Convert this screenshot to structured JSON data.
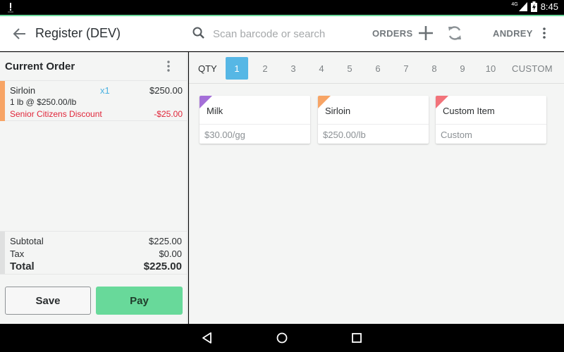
{
  "status_bar": {
    "network": "4G",
    "time": "8:45"
  },
  "app_bar": {
    "title": "Register (DEV)",
    "search_placeholder": "Scan barcode or search",
    "orders_label": "ORDERS",
    "user_label": "ANDREY"
  },
  "current_order": {
    "title": "Current Order",
    "items": [
      {
        "name": "Sirloin",
        "qty": "x1",
        "price": "$250.00",
        "detail": "1 lb @ $250.00/lb",
        "discount_name": "Senior Citizens Discount",
        "discount_value": "-$25.00",
        "color": "#f7a465"
      }
    ],
    "totals": {
      "subtotal_label": "Subtotal",
      "subtotal": "$225.00",
      "tax_label": "Tax",
      "tax": "$0.00",
      "total_label": "Total",
      "total": "$225.00"
    },
    "save_label": "Save",
    "pay_label": "Pay"
  },
  "qty_bar": {
    "label": "QTY",
    "options": [
      "1",
      "2",
      "3",
      "4",
      "5",
      "6",
      "7",
      "8",
      "9",
      "10"
    ],
    "selected": "1",
    "custom_label": "CUSTOM"
  },
  "products": [
    {
      "name": "Milk",
      "price": "$30.00/gg",
      "color": "#a46fd8"
    },
    {
      "name": "Sirloin",
      "price": "$250.00/lb",
      "color": "#f7a465"
    },
    {
      "name": "Custom Item",
      "price": "Custom",
      "color": "#f2737a"
    }
  ],
  "colors": {
    "accent": "#6bd99c",
    "pay_button": "#68d99a",
    "qty_selected": "#56b7e5",
    "discount": "#e0263a"
  }
}
